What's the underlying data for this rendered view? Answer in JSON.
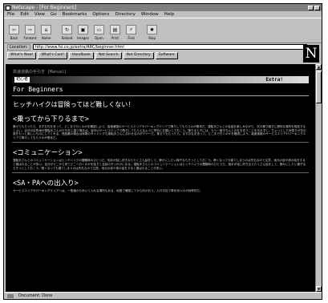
{
  "window": {
    "title": "Netscape - [For Beginners]"
  },
  "menu": [
    "File",
    "Edit",
    "View",
    "Go",
    "Bookmarks",
    "Options",
    "Directory",
    "Window",
    "Help"
  ],
  "toolbar": [
    {
      "label": "Back",
      "icon": "back-arrow-icon",
      "glyph": "⇦"
    },
    {
      "label": "Forward",
      "icon": "forward-arrow-icon",
      "glyph": "⇨"
    },
    {
      "label": "Home",
      "icon": "home-icon",
      "glyph": "⌂"
    },
    {
      "label": "Reload",
      "icon": "reload-icon",
      "glyph": "↻"
    },
    {
      "label": "Images",
      "icon": "images-icon",
      "glyph": "▣"
    },
    {
      "label": "Open",
      "icon": "open-icon",
      "glyph": "▭"
    },
    {
      "label": "Print",
      "icon": "print-icon",
      "glyph": "▤"
    },
    {
      "label": "Find",
      "icon": "find-icon",
      "glyph": "⌕"
    },
    {
      "label": "Stop",
      "icon": "stop-icon",
      "glyph": "✹"
    }
  ],
  "location": {
    "label": "Location:",
    "url": "http://www.fsi.co.jp/extra/ARC/beginner.html"
  },
  "directory_buttons": [
    "What's New!",
    "What's Cool!",
    "Handbook",
    "Net Search",
    "Net Directory",
    "Software"
  ],
  "logo": "N",
  "page": {
    "breadcrumb": "高速道路の手引き [Manual]",
    "banner_tag": "初心者",
    "banner_extra": "Extra!",
    "title": "For Beginners",
    "subtitle": "ヒッチハイクは冒険ってほど難しくない!",
    "sections": [
      {
        "heading": "<乗ってから下りるまで>",
        "text": "乗せてもらったら、まずお礼を言って、どこまで行くのかを確認しよう。高速道路のサービスエリアやパーキングエリアで降ろしてもらうのが基本だ。運転手さんとの会話を楽しみながら、次の乗り継ぎに便利な場所を相談するとよい。自分の目的地が運転手さんの行き先と違う場合は、途中のサービスエリアで降ろしてもらえるように早めにお願いしておこう。降りるときには、もう一度きちんとお礼を言うことを忘れずに。ちょっとした気配りが次の旅をもっと楽しいものにしてくれる。長距離の場合は休憩のタイミングも運転手さんに合わせるのがマナーだ。乗せてもらったら、まずお礼を言って、どこまで行くのかを確認しよう。高速道路のサービスエリアやパーキングエリアで降ろしてもらうのが基本だ。"
      },
      {
        "heading": "<コミュニケーション>",
        "text": "運転手さんとのコミュニケーションはヒッチハイクの醍醐味のひとつだ。相手が話し好きならたくさん話をして、静かにしたい様子ならそっとしておこう。眠くなっても寝てしまうのは失礼なので注意。地元の話や旅の話をすると喜ばれることが多い。自分がどこから来てどこへ行くのかを話すと会話のきっかけになる。運転手さんとのコミュニケーションはヒッチハイクの醍醐味のひとつだ。相手が話し好きならたくさん話をして、静かにしたい様子ならそっとしておこう。眠くなっても寝てしまうのは失礼なので注意。地元の話や旅の話をすると喜ばれることが多い。"
      },
      {
        "heading": "<SA・PAへの出入り>",
        "text": "サービスエリアやパーキングエリアへは、一般道から歩いて入れる場所もある。地図で確認してから向かおう。入口付近で車を待つのが効率的だ。"
      }
    ]
  },
  "status": {
    "text": "Document: Done"
  }
}
